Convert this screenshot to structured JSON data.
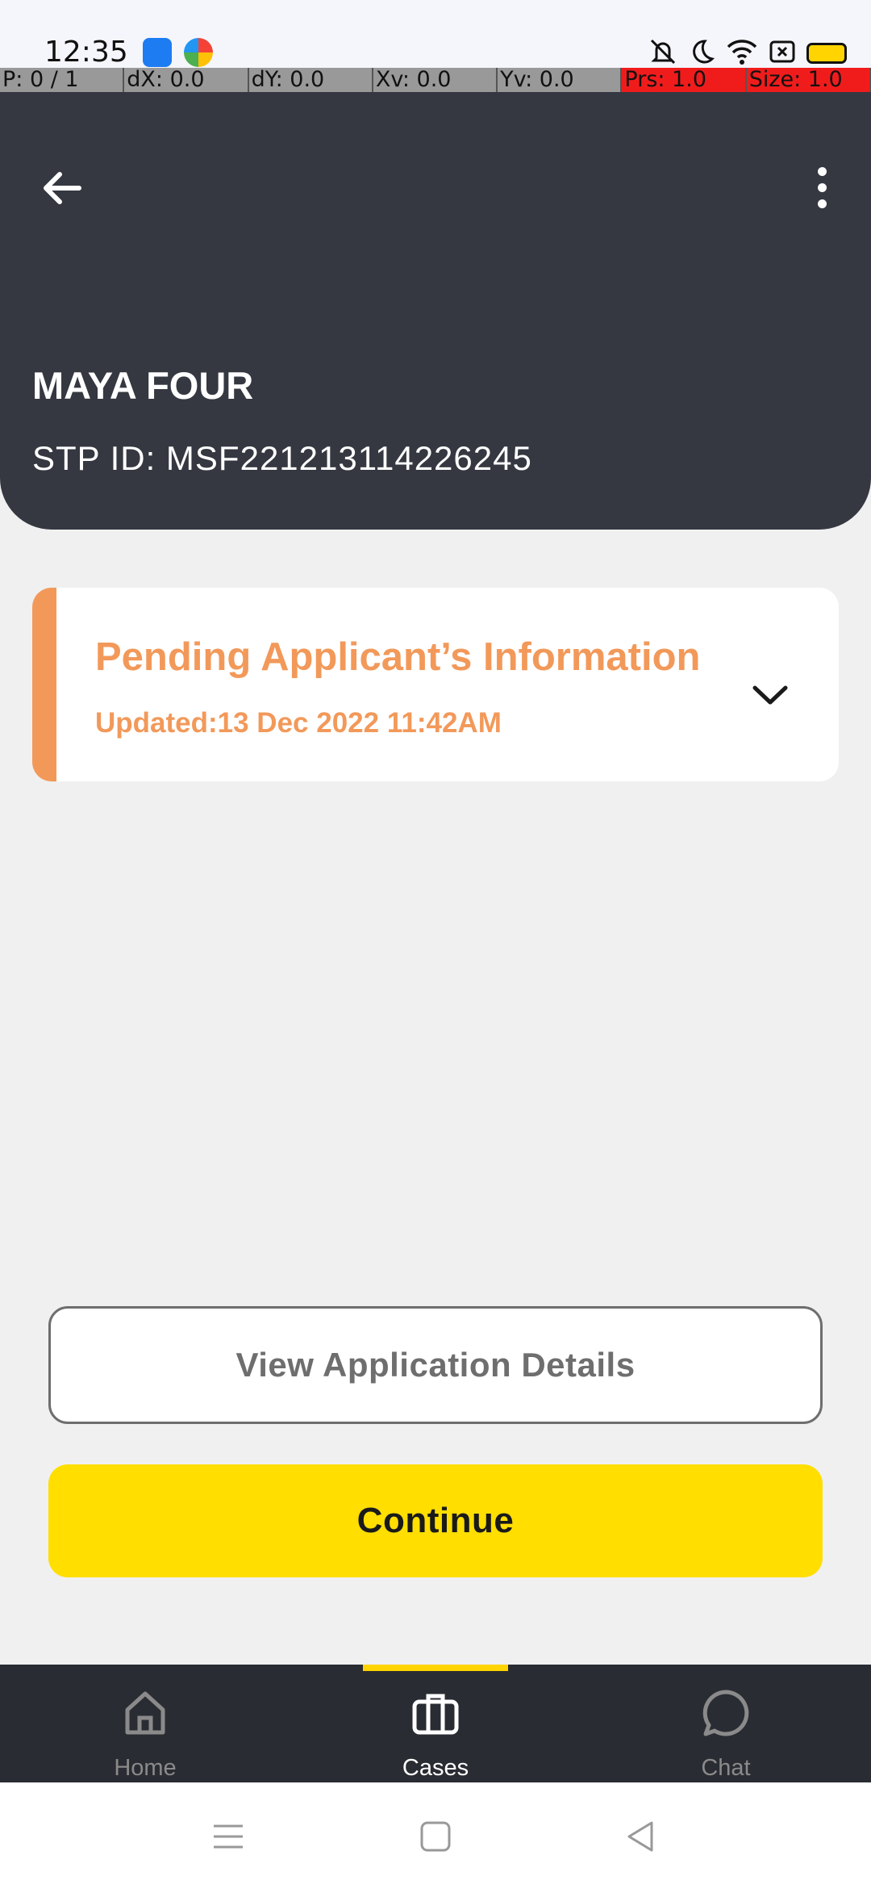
{
  "status_bar": {
    "time": "12:35"
  },
  "debug_bar": [
    "P: 0 / 1",
    "dX: 0.0",
    "dY: 0.0",
    "Xv: 0.0",
    "Yv: 0.0",
    "Prs: 1.0",
    "Size: 1.0"
  ],
  "header": {
    "name": "MAYA FOUR",
    "stp_id": "STP ID: MSF221213114226245"
  },
  "status_card": {
    "title": "Pending Applicant’s Information",
    "updated": "Updated:13 Dec 2022 11:42AM",
    "accent_color": "#f2995a"
  },
  "actions": {
    "view_details": "View Application Details",
    "continue": "Continue"
  },
  "bottom_nav": {
    "items": [
      {
        "label": "Home",
        "icon": "home-icon",
        "active": false
      },
      {
        "label": "Cases",
        "icon": "briefcase-icon",
        "active": true
      },
      {
        "label": "Chat",
        "icon": "chat-bubble-icon",
        "active": false
      }
    ],
    "active_color": "#ffd400"
  }
}
